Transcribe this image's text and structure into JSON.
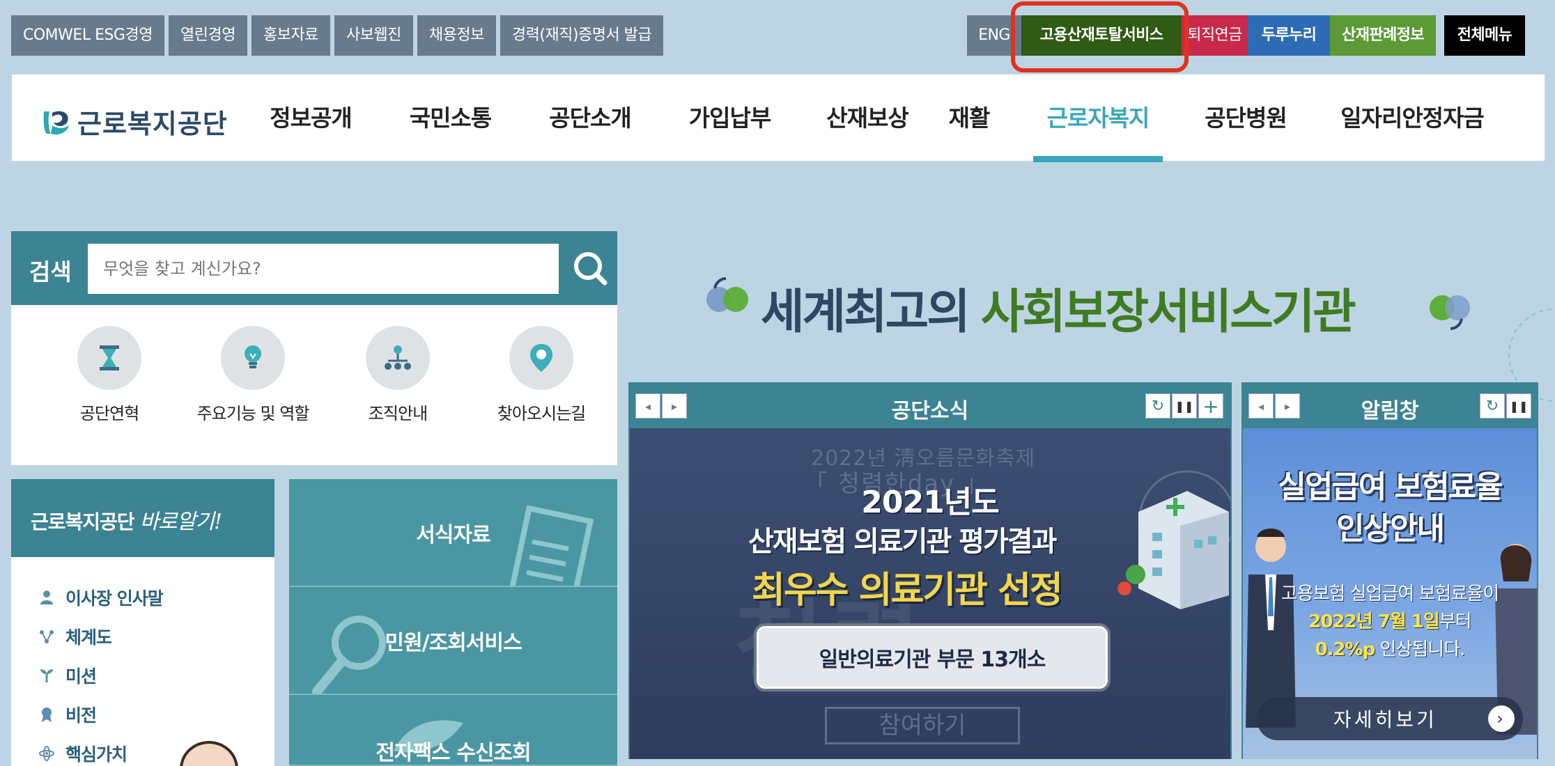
{
  "util_left": [
    "COMWEL ESG경영",
    "열린경영",
    "홍보자료",
    "사보웹진",
    "채용정보",
    "경력(재직)증명서 발급"
  ],
  "util_right": {
    "eng": "ENG",
    "total": "고용산재토탈서비스",
    "pension": "퇴직연금",
    "dururi": "두루누리",
    "case": "산재판례정보",
    "allmenu": "전체메뉴"
  },
  "logo": {
    "text": "근로복지공단"
  },
  "gnb": [
    "정보공개",
    "국민소통",
    "공단소개",
    "가입납부",
    "산재보상",
    "재활",
    "근로자복지",
    "공단병원",
    "일자리안정자금"
  ],
  "gnb_active": "근로자복지",
  "search": {
    "label": "검색",
    "placeholder": "무엇을 찾고 계신가요?"
  },
  "quick": [
    "공단연혁",
    "주요기능 및 역할",
    "조직안내",
    "찾아오시는길"
  ],
  "baro": {
    "title": "근로복지공단",
    "script": "바로알기!",
    "items": [
      "이사장 인사말",
      "체계도",
      "미션",
      "비전",
      "핵심가치"
    ]
  },
  "services": [
    "서식자료",
    "민원/조회서비스",
    "전자팩스 수신조회"
  ],
  "slogan": {
    "part1": "세계최고의",
    "part2": "사회보장서비스기관"
  },
  "news": {
    "title": "공단소식",
    "faded_top": "2022년 淸오름문화축제",
    "faded_sub": "「 청렴한day 」",
    "line1": "2021년도",
    "line2": "산재보험 의료기관 평가결과",
    "line3": "최우수 의료기관 선정",
    "button": "일반의료기관 부문 13개소",
    "faded_btn": "참여하기"
  },
  "notice": {
    "title": "알림창",
    "headline1": "실업급여 보험료율",
    "headline2": "인상안내",
    "text1": "고용보험 실업급여 보험료율이",
    "date": "2022년 7월 1일",
    "text2_suffix": "부터",
    "rate": "0.2%p",
    "text3_suffix": " 인상됩니다.",
    "more": "자세히보기"
  },
  "colors": {
    "background": "#bdd4e4",
    "teal": "#3c8393",
    "active": "#3aa6ba",
    "total_service": "#2f5b15",
    "highlight_ring": "#e0321c"
  }
}
